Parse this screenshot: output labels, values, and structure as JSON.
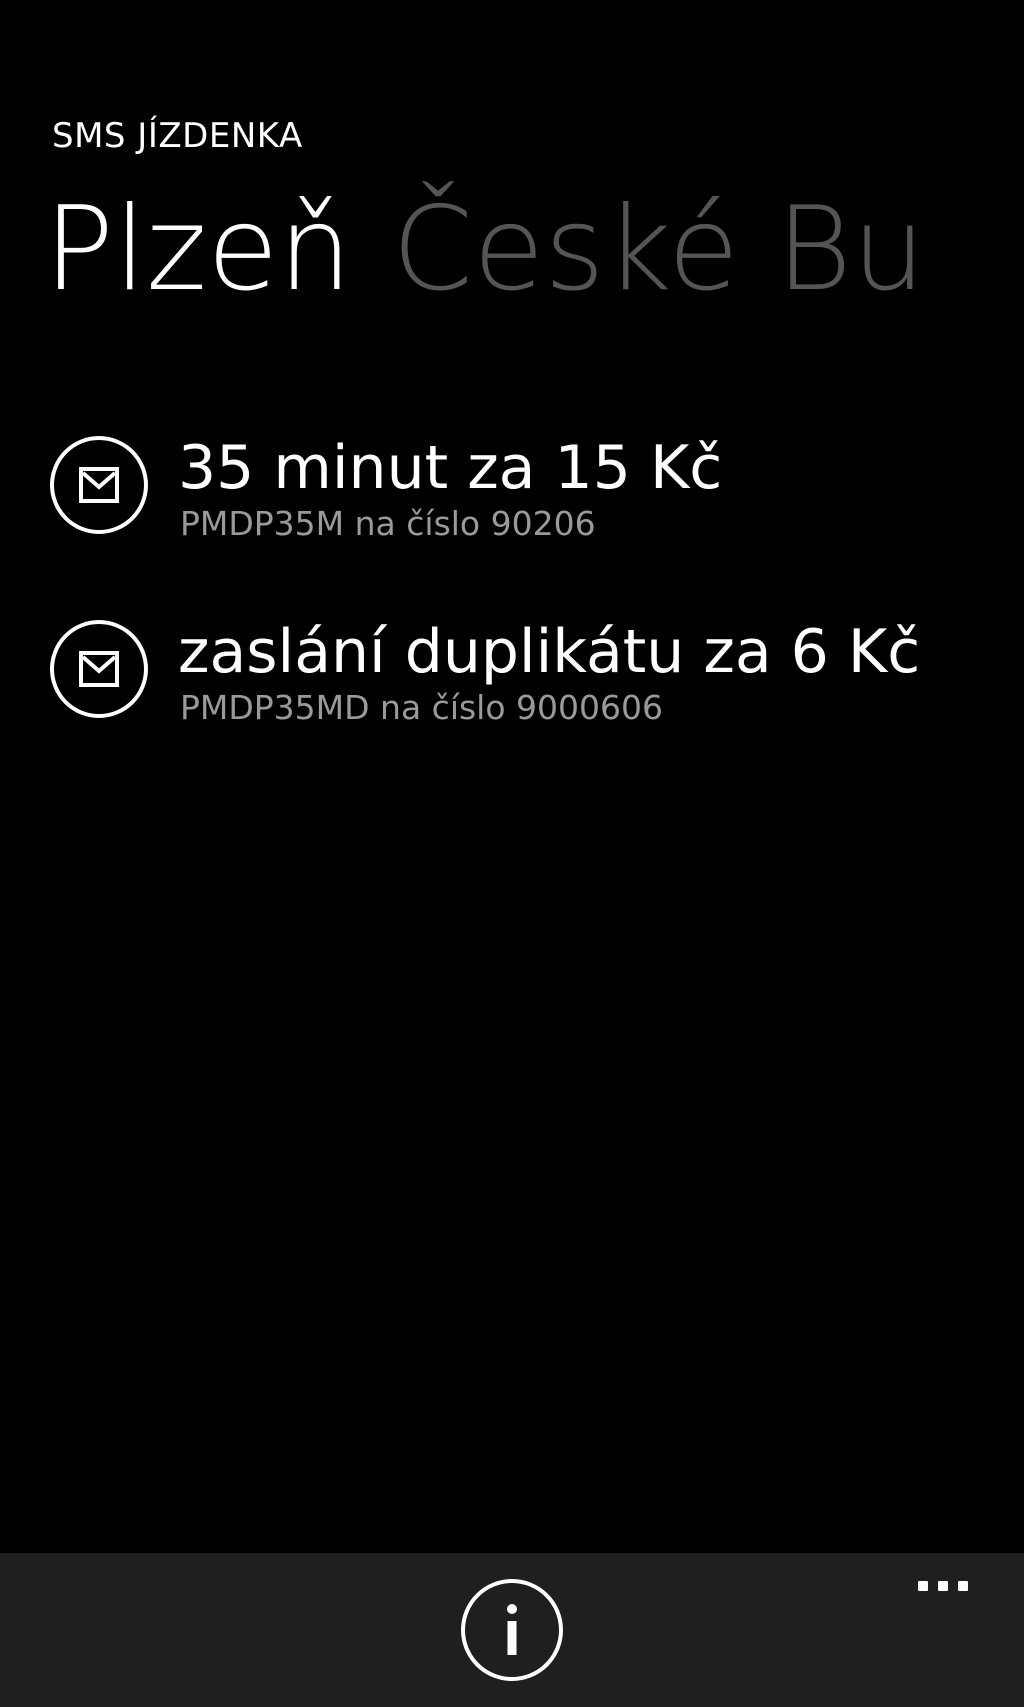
{
  "app": {
    "title": "SMS JÍZDENKA"
  },
  "pivot": {
    "items": [
      {
        "label": "Plzeň",
        "active": true
      },
      {
        "label": "České Bu",
        "active": false
      }
    ]
  },
  "tickets": [
    {
      "title": "35 minut za 15 Kč",
      "subtitle": "PMDP35M na číslo 90206",
      "icon": "envelope-icon"
    },
    {
      "title": "zaslání duplikátu za 6 Kč",
      "subtitle": "PMDP35MD na číslo 9000606",
      "icon": "envelope-icon"
    }
  ],
  "app_bar": {
    "buttons": [
      {
        "icon": "info-icon"
      },
      {
        "icon": "more-icon"
      }
    ],
    "background": "#1f1f1f"
  },
  "colors": {
    "background": "#000000",
    "foreground": "#ffffff",
    "inactive_pivot": "#555555",
    "subtitle": "#9a9a9a"
  }
}
